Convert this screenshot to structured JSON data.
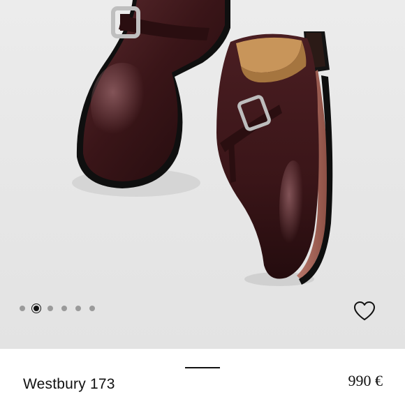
{
  "gallery": {
    "image_alt": "burgundy monk strap shoes",
    "dots_count": 6,
    "active_index": 1,
    "wishlist_icon": "heart-outline-icon"
  },
  "product": {
    "name": "Westbury 173",
    "price": "990 €"
  },
  "colors": {
    "leather": "#3a1518",
    "background": "#e6e6e6",
    "text": "#111111"
  }
}
